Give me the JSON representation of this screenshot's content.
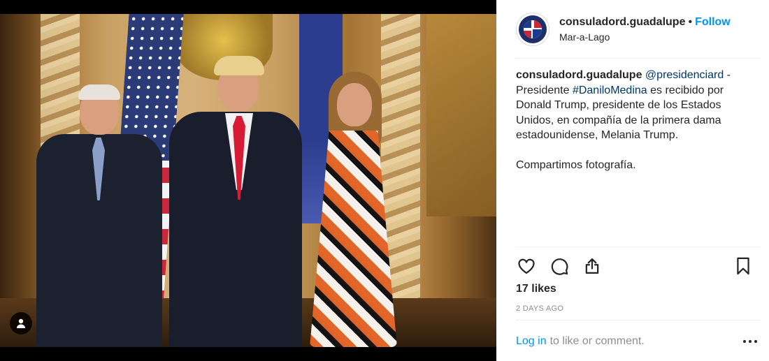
{
  "post": {
    "username": "consuladord.guadalupe",
    "separator": "•",
    "follow_label": "Follow",
    "location": "Mar-a-Lago",
    "caption": {
      "username": "consuladord.guadalupe",
      "mention": "@presidenciard",
      "dash": " - ",
      "text_before_hashtag": "Presidente ",
      "hashtag": "#DaniloMedina",
      "text_after_hashtag": " es recibido por Donald Trump, presidente de los Estados Unidos, en compañía de la primera dama estadounidense, Melania Trump.",
      "second_paragraph": "Compartimos fotografía."
    },
    "likes_label": "17 likes",
    "timestamp": "2 DAYS AGO",
    "login_link": "Log in",
    "login_rest": "to like or comment."
  },
  "icons": {
    "like": "heart-icon",
    "comment": "comment-icon",
    "share": "share-icon",
    "save": "bookmark-icon",
    "more": "more-options-icon",
    "user_tag": "user-tag-icon"
  },
  "colors": {
    "link_blue": "#0095f6",
    "mention_blue": "#00376b",
    "text": "#262626",
    "muted": "#8e8e8e"
  }
}
